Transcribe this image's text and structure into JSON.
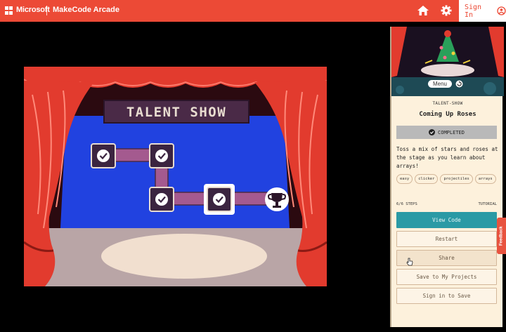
{
  "header": {
    "brand": "Microsoft",
    "product": "MakeCode Arcade",
    "sign_in": "Sign In",
    "icons": [
      "microsoft-logo",
      "home-icon",
      "gear-icon",
      "user-icon"
    ],
    "accent": "#ec4a36"
  },
  "stage": {
    "banner": "TALENT SHOW",
    "nodes_completed": 6,
    "trophy_icon": "trophy-icon"
  },
  "panel": {
    "menu_label": "Menu",
    "kicker": "TALENT-SHOW",
    "title": "Coming Up Roses",
    "status": "COMPLETED",
    "description": "Toss a mix of stars and roses at the stage as you learn about arrays!",
    "tags": [
      "easy",
      "clicker",
      "projectiles",
      "arrays"
    ],
    "steps": "6/6 STEPS",
    "kind": "TUTORIAL",
    "buttons": {
      "view_code": "View Code",
      "restart": "Restart",
      "share": "Share",
      "save": "Save to My Projects",
      "sign_in_save": "Sign in to Save"
    }
  },
  "feedback": "Feedback"
}
